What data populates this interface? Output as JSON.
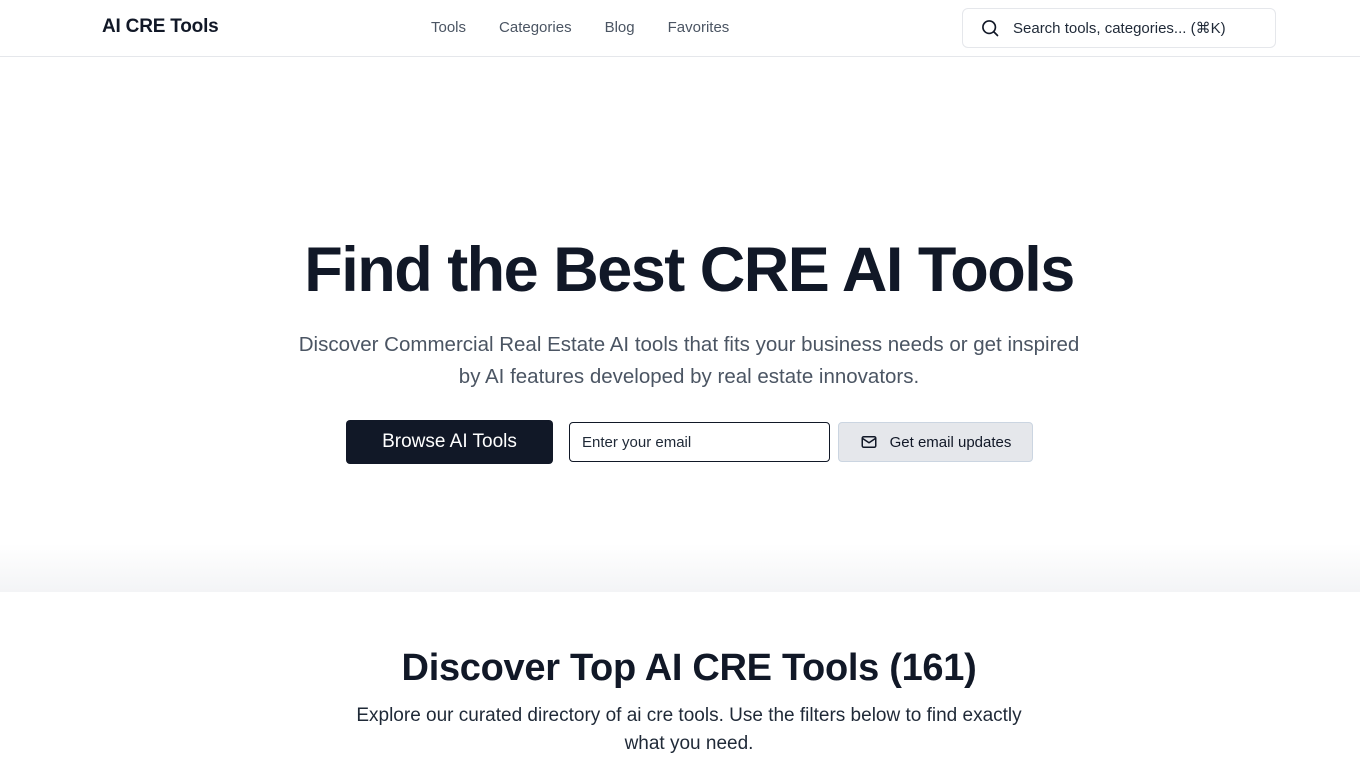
{
  "header": {
    "brand": "AI CRE Tools",
    "nav": [
      {
        "label": "Tools"
      },
      {
        "label": "Categories"
      },
      {
        "label": "Blog"
      },
      {
        "label": "Favorites"
      }
    ],
    "search": {
      "icon": "search-icon",
      "placeholder": "Search tools, categories... (⌘K)"
    }
  },
  "hero": {
    "title": "Find the Best CRE AI Tools",
    "subtitle": "Discover Commercial Real Estate AI tools that fits your business needs or get inspired by AI features developed by real estate innovators.",
    "browse_label": "Browse AI Tools",
    "email_placeholder": "Enter your email",
    "updates_label": "Get email updates",
    "updates_icon": "mail-icon"
  },
  "discover": {
    "title": "Discover Top AI CRE Tools (161)",
    "subtitle": "Explore our curated directory of ai cre tools. Use the filters below to find exactly what you need."
  },
  "colors": {
    "primary": "#111827",
    "muted_text": "#4b5563",
    "border": "#e5e7eb",
    "secondary_button_bg": "#e5e7eb"
  }
}
